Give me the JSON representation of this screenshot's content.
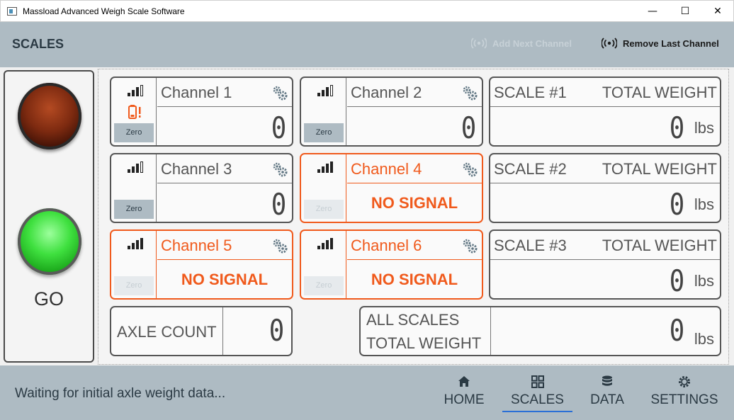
{
  "window": {
    "title": "Massload Advanced Weigh Scale Software",
    "minimize_glyph": "—",
    "maximize_glyph": "☐",
    "close_glyph": "✕"
  },
  "header": {
    "title": "SCALES",
    "add_channel_label": "Add Next Channel",
    "remove_channel_label": "Remove Last Channel"
  },
  "traffic_light": {
    "status_label": "GO"
  },
  "channels": [
    {
      "name": "Channel 1",
      "value": "0",
      "zero_label": "Zero",
      "state": "ok"
    },
    {
      "name": "Channel 2",
      "value": "0",
      "zero_label": "Zero",
      "state": "ok"
    },
    {
      "name": "Channel 3",
      "value": "0",
      "zero_label": "Zero",
      "state": "ok"
    },
    {
      "name": "Channel 4",
      "value": "NO SIGNAL",
      "zero_label": "Zero",
      "state": "no-signal"
    },
    {
      "name": "Channel 5",
      "value": "NO SIGNAL",
      "zero_label": "Zero",
      "state": "no-signal"
    },
    {
      "name": "Channel 6",
      "value": "NO SIGNAL",
      "zero_label": "Zero",
      "state": "no-signal"
    }
  ],
  "scales": [
    {
      "name": "SCALE #1",
      "label": "TOTAL WEIGHT",
      "value": "0",
      "unit": "lbs"
    },
    {
      "name": "SCALE #2",
      "label": "TOTAL WEIGHT",
      "value": "0",
      "unit": "lbs"
    },
    {
      "name": "SCALE #3",
      "label": "TOTAL WEIGHT",
      "value": "0",
      "unit": "lbs"
    }
  ],
  "axle": {
    "label": "AXLE COUNT",
    "value": "0"
  },
  "all_scales": {
    "label_line1": "ALL SCALES",
    "label_line2": "TOTAL WEIGHT",
    "value": "0",
    "unit": "lbs"
  },
  "footer": {
    "status": "Waiting for initial axle weight data...",
    "nav": [
      {
        "label": "HOME",
        "icon": "home-icon",
        "active": false
      },
      {
        "label": "SCALES",
        "icon": "grid-icon",
        "active": true
      },
      {
        "label": "DATA",
        "icon": "database-icon",
        "active": false
      },
      {
        "label": "SETTINGS",
        "icon": "gear-icon",
        "active": false
      }
    ]
  },
  "colors": {
    "accent": "#f05a1c",
    "band": "#aebbc3",
    "go_green": "#3fe03f",
    "stop_red": "#7d2a10",
    "active_underline": "#2a6fd6"
  }
}
